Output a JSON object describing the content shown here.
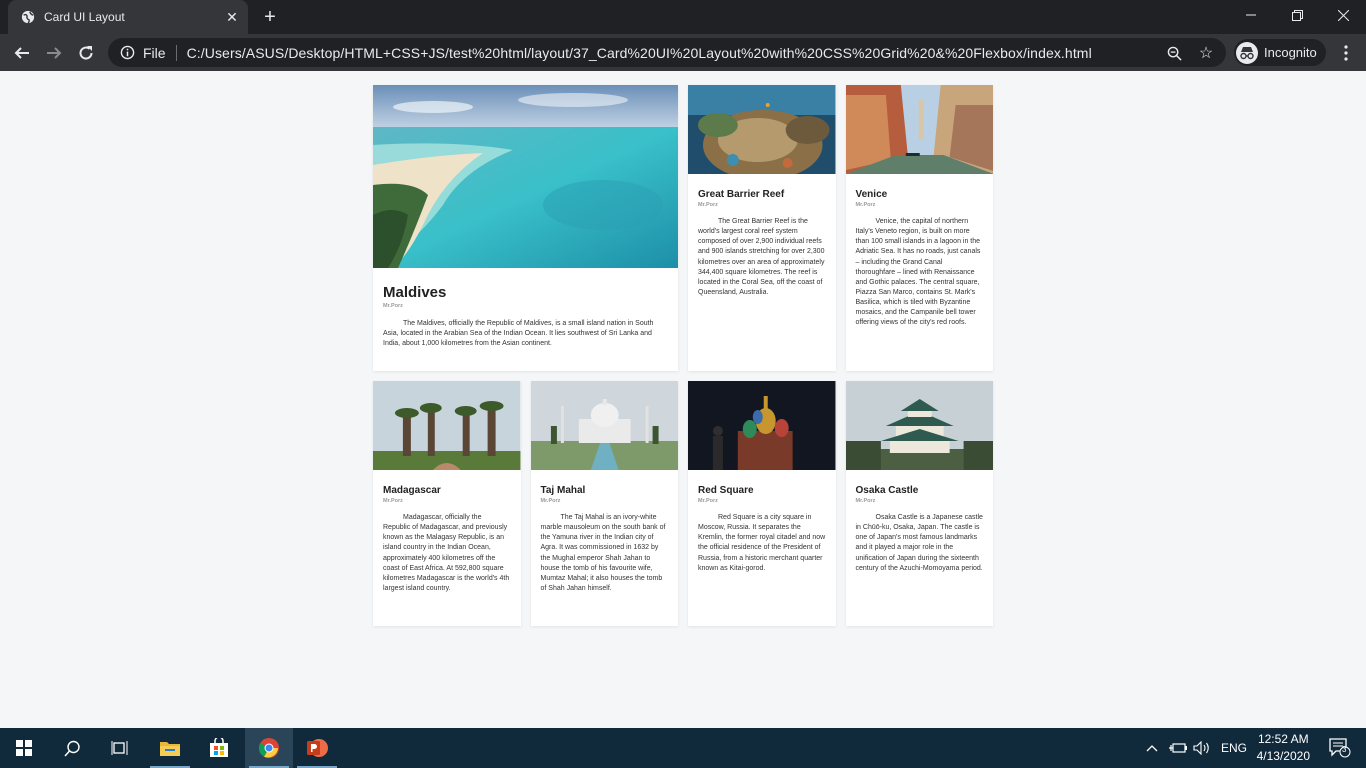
{
  "browser": {
    "tab_title": "Card UI Layout",
    "omnibox_label": "File",
    "url": "C:/Users/ASUS/Desktop/HTML+CSS+JS/test%20html/layout/37_Card%20UI%20Layout%20with%20CSS%20Grid%20&%20Flexbox/index.html",
    "profile_label": "Incognito"
  },
  "cards": [
    {
      "title": "Maldives",
      "author": "Mr.Porz",
      "text": "The Maldives, officially the Republic of Maldives, is a small island nation in South Asia, located in the Arabian Sea of the Indian Ocean. It lies southwest of Sri Lanka and India, about 1,000 kilometres from the Asian continent.",
      "image": "beach-aerial"
    },
    {
      "title": "Great Barrier Reef",
      "author": "Mr.Porz",
      "text": "The Great Barrier Reef is the world's largest coral reef system composed of over 2,900 individual reefs and 900 islands stretching for over 2,300 kilometres over an area of approximately 344,400 square kilometres. The reef is located in the Coral Sea, off the coast of Queensland, Australia.",
      "image": "coral-reef"
    },
    {
      "title": "Venice",
      "author": "Mr.Porz",
      "text": "Venice, the capital of northern Italy's Veneto region, is built on more than 100 small islands in a lagoon in the Adriatic Sea. It has no roads, just canals – including the Grand Canal thoroughfare – lined with Renaissance and Gothic palaces. The central square, Piazza San Marco, contains St. Mark's Basilica, which is tiled with Byzantine mosaics, and the Campanile bell tower offering views of the city's red roofs.",
      "image": "venice-canal"
    },
    {
      "title": "Madagascar",
      "author": "Mr.Porz",
      "text": "Madagascar, officially the Republic of Madagascar, and previously known as the Malagasy Republic, is an island country in the Indian Ocean, approximately 400 kilometres off the coast of East Africa. At 592,800 square kilometres Madagascar is the world's 4th largest island country.",
      "image": "baobab-trees"
    },
    {
      "title": "Taj Mahal",
      "author": "Mr.Porz",
      "text": "The Taj Mahal is an ivory-white marble mausoleum on the south bank of the Yamuna river in the Indian city of Agra. It was commissioned in 1632 by the Mughal emperor Shah Jahan to house the tomb of his favourite wife, Mumtaz Mahal; it also houses the tomb of Shah Jahan himself.",
      "image": "taj-mahal"
    },
    {
      "title": "Red Square",
      "author": "Mr.Porz",
      "text": "Red Square is a city square in Moscow, Russia. It separates the Kremlin, the former royal citadel and now the official residence of the President of Russia, from a historic merchant quarter known as Kitai-gorod.",
      "image": "st-basils-cathedral"
    },
    {
      "title": "Osaka Castle",
      "author": "Mr.Porz",
      "text": "Osaka Castle is a Japanese castle in Chūō-ku, Osaka, Japan. The castle is one of Japan's most famous landmarks and it played a major role in the unification of Japan during the sixteenth century of the Azuchi-Momoyama period.",
      "image": "osaka-castle"
    }
  ],
  "taskbar": {
    "language": "ENG",
    "time": "12:52 AM",
    "date": "4/13/2020",
    "notification_count": "3"
  },
  "colors": {
    "page_bg": "#f5f6f8",
    "chrome_dark": "#202124",
    "chrome_toolbar": "#35363a",
    "taskbar": "#102a3c"
  }
}
